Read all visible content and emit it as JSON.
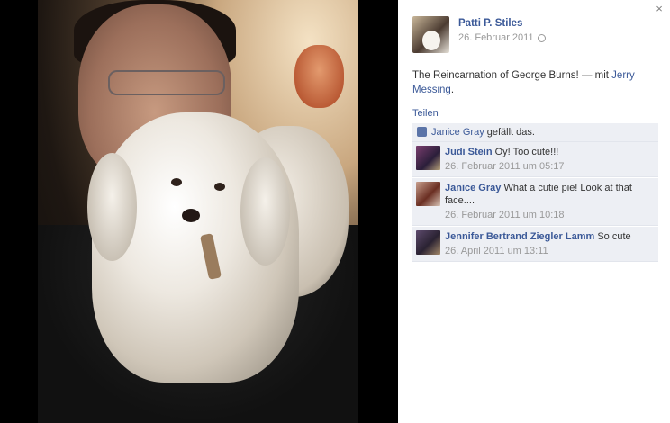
{
  "close_glyph": "×",
  "post": {
    "author": "Patti P. Stiles",
    "date": "26. Februar 2011",
    "privacy_icon": "globe-icon",
    "caption": "The Reincarnation of George Burns!",
    "with_text": " — mit ",
    "tagged": "Jerry Messing",
    "tagged_suffix": "."
  },
  "share_label": "Teilen",
  "likes": {
    "name": "Janice Gray",
    "suffix": " gefällt das."
  },
  "comments": [
    {
      "name": "Judi Stein",
      "text": "Oy! Too cute!!!",
      "time": "26. Februar 2011 um 05:17"
    },
    {
      "name": "Janice Gray",
      "text": "What a cutie pie! Look at that face....",
      "time": "26. Februar 2011 um 10:18"
    },
    {
      "name": "Jennifer Bertrand Ziegler Lamm",
      "text": "So cute",
      "time": "26. April 2011 um 13:11"
    }
  ],
  "colors": {
    "link": "#3b5998",
    "panel": "#edeff4",
    "meta": "#999999"
  }
}
